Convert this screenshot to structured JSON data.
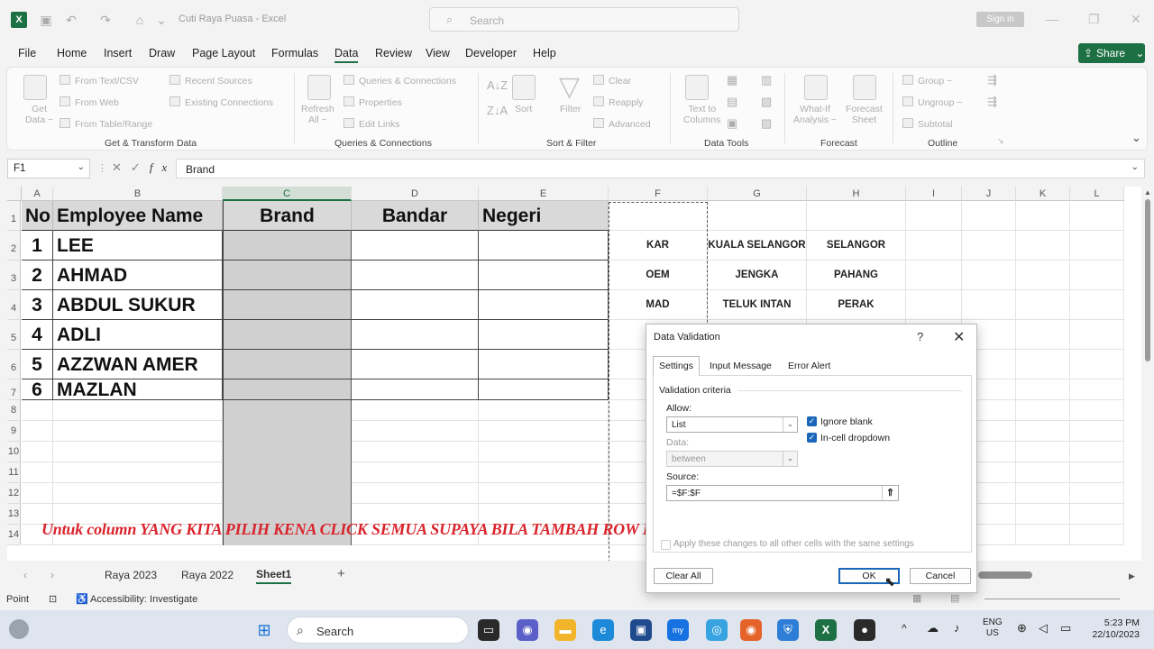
{
  "titlebar": {
    "app_icon": "X",
    "doc_title": "Cuti Raya Puasa  -  Excel",
    "search_placeholder": "Search",
    "signin_label": "Sign in"
  },
  "menu": {
    "items": [
      "File",
      "Home",
      "Insert",
      "Draw",
      "Page Layout",
      "Formulas",
      "Data",
      "Review",
      "View",
      "Developer",
      "Help"
    ],
    "active": "Data",
    "share_label": "Share"
  },
  "ribbon": {
    "get_transform": {
      "get_data": [
        "Get",
        "Data ~"
      ],
      "from_text": "From Text/CSV",
      "from_web": "From Web",
      "from_table": "From Table/Range",
      "recent_sources": "Recent Sources",
      "existing_connections": "Existing Connections",
      "label": "Get & Transform Data"
    },
    "queries": {
      "refresh": [
        "Refresh",
        "All ~"
      ],
      "queries_connections": "Queries & Connections",
      "properties": "Properties",
      "edit_links": "Edit Links",
      "label": "Queries & Connections"
    },
    "sort_filter": {
      "sort": "Sort",
      "filter": "Filter",
      "clear": "Clear",
      "reapply": "Reapply",
      "advanced": "Advanced",
      "label": "Sort & Filter"
    },
    "data_tools": {
      "text_to_columns": [
        "Text to",
        "Columns"
      ],
      "label": "Data Tools"
    },
    "forecast": {
      "what_if": [
        "What-If",
        "Analysis ~"
      ],
      "forecast_sheet": [
        "Forecast",
        "Sheet"
      ],
      "label": "Forecast"
    },
    "outline": {
      "group": "Group ~",
      "ungroup": "Ungroup ~",
      "subtotal": "Subtotal",
      "label": "Outline"
    }
  },
  "formula_bar": {
    "name_box": "F1",
    "fx": "fx",
    "value": "Brand"
  },
  "columns": [
    "A",
    "B",
    "C",
    "D",
    "E",
    "F",
    "G",
    "H",
    "I",
    "J",
    "K",
    "L"
  ],
  "rows": [
    "1",
    "2",
    "3",
    "4",
    "5",
    "6",
    "7",
    "8",
    "9",
    "10",
    "11",
    "12",
    "13",
    "14"
  ],
  "table": {
    "headers": [
      "No",
      "Employee Name",
      "Brand",
      "Bandar",
      "Negeri"
    ],
    "rows": [
      {
        "no": "1",
        "name": "LEE"
      },
      {
        "no": "2",
        "name": "AHMAD"
      },
      {
        "no": "3",
        "name": "ABDUL SUKUR"
      },
      {
        "no": "4",
        "name": "ADLI"
      },
      {
        "no": "5",
        "name": "AZZWAN AMER"
      },
      {
        "no": "6",
        "name": "MAZLAN"
      }
    ]
  },
  "lookup": [
    {
      "brand": "KAR",
      "bandar": "KUALA SELANGOR",
      "negeri": "SELANGOR"
    },
    {
      "brand": "OEM",
      "bandar": "JENGKA",
      "negeri": "PAHANG"
    },
    {
      "brand": "MAD",
      "bandar": "TELUK INTAN",
      "negeri": "PERAK"
    }
  ],
  "overlay_caption": "Untuk column YANG KITA PILIH KENA CLICK SEMUA SUPAYA BILA TAMBAH ROW DIA AUTO SEMUA SUDAH ADA FORMAT",
  "sheet_tabs": [
    "Raya 2023",
    "Raya 2022",
    "Sheet1"
  ],
  "active_sheet": "Sheet1",
  "status": {
    "mode": "Point",
    "accessibility": "Accessibility: Investigate"
  },
  "dialog": {
    "title": "Data Validation",
    "help": "?",
    "close": "✕",
    "tabs": [
      "Settings",
      "Input Message",
      "Error Alert"
    ],
    "criteria_label": "Validation criteria",
    "allow_label": "Allow:",
    "allow_value": "List",
    "ignore_blank": "Ignore blank",
    "incell_dropdown": "In-cell dropdown",
    "data_label": "Data:",
    "data_value": "between",
    "source_label": "Source:",
    "source_value": "=$F:$F",
    "apply_all": "Apply these changes to all other cells with the same settings",
    "clear_all": "Clear All",
    "ok": "OK",
    "cancel": "Cancel"
  },
  "taskbar": {
    "search_placeholder": "Search",
    "lang_1": "ENG",
    "lang_2": "US",
    "time": "5:23 PM",
    "date": "22/10/2023"
  },
  "colors": {
    "excel_green": "#1d7044",
    "overlay_red": "#d9242c",
    "selection_gray": "#d0d0d0",
    "dialog_blue": "#1a66b8"
  }
}
